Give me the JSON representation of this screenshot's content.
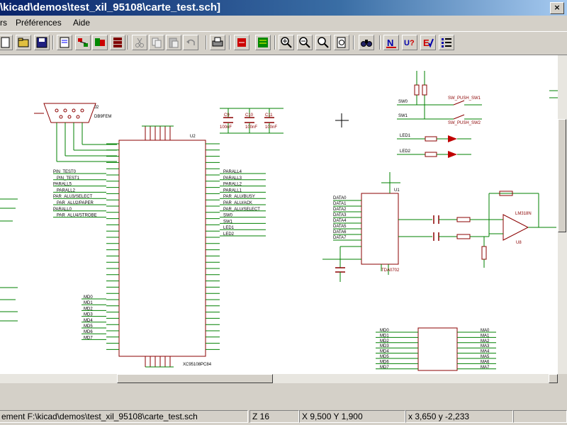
{
  "window": {
    "title": "\\kicad\\demos\\test_xil_95108\\carte_test.sch]",
    "close_glyph": "×"
  },
  "menu": {
    "items": [
      "rs",
      "Préférences",
      "Aide"
    ]
  },
  "toolbar": {
    "icons": [
      "new-sheet-icon",
      "open-icon",
      "save-icon",
      "sheet-setup-icon",
      "hierarchy-nav-icon",
      "annotate-icon",
      "bom-icon",
      "cut-icon",
      "copy-icon",
      "paste-icon",
      "undo-icon",
      "print-icon",
      "library-editor-icon",
      "library-browser-icon",
      "zoom-in-icon",
      "zoom-out-icon",
      "zoom-redraw-icon",
      "zoom-auto-icon",
      "find-icon",
      "netlist-icon",
      "erc-icon",
      "drc-icon",
      "bom-list-icon"
    ]
  },
  "schematic": {
    "colors": {
      "wire": "#008000",
      "component": "#8b0000",
      "label": "#000000",
      "bus": "#00008b",
      "led": "#c00000"
    },
    "components": {
      "db9": {
        "ref": "J2",
        "value": "DB9FEM"
      },
      "cpu": {
        "ref": "U2",
        "value": "XC95108PC84"
      },
      "dac": {
        "ref": "U1",
        "value": "TDA0702"
      },
      "opamp": {
        "ref": "U8",
        "value": "LM318N"
      },
      "caps": [
        "C9",
        "C10",
        "C11"
      ],
      "caps_value": "100nF",
      "switches": [
        "SW0",
        "SW1"
      ],
      "switch_labels": [
        "SW_PUSH_SW1",
        "SW_PUSH_SW2"
      ],
      "leds": [
        "LED1",
        "LED2"
      ],
      "nets_left": [
        "PIN_TEST0",
        "PIN_TEST1",
        "PARALL5",
        "PARALL2",
        "PAR_ALU3/SELECT",
        "PAR_ALU2/PAPER",
        "PARALL0",
        "PAR_ALU4/STROBE"
      ],
      "nets_right": [
        "PARALL4",
        "PARALL3",
        "PARALL2",
        "PARALL1",
        "PAR_ALU/BUSY",
        "PAR_ALU/ACK",
        "PAR_ALU/SELECT",
        "SW0",
        "SW1",
        "LED1",
        "LED2"
      ],
      "data_bus": [
        "DATA0",
        "DATA1",
        "DATA2",
        "DATA3",
        "DATA4",
        "DATA5",
        "DATA6",
        "DATA7"
      ],
      "memory_left": [
        "MD0",
        "MD1",
        "MD2",
        "MD3",
        "MD4",
        "MD5",
        "MD6",
        "MD7"
      ],
      "memory_right": [
        "MA0",
        "MA1",
        "MA2",
        "MA3",
        "MA4",
        "MA5",
        "MA6",
        "MA7"
      ]
    }
  },
  "status": {
    "file": "ement F:\\kicad\\demos\\test_xil_95108\\carte_test.sch",
    "zoom": "Z 16",
    "abs_coords": "X 9,500  Y 1,900",
    "rel_coords": "x 3,650  y -2,233"
  }
}
